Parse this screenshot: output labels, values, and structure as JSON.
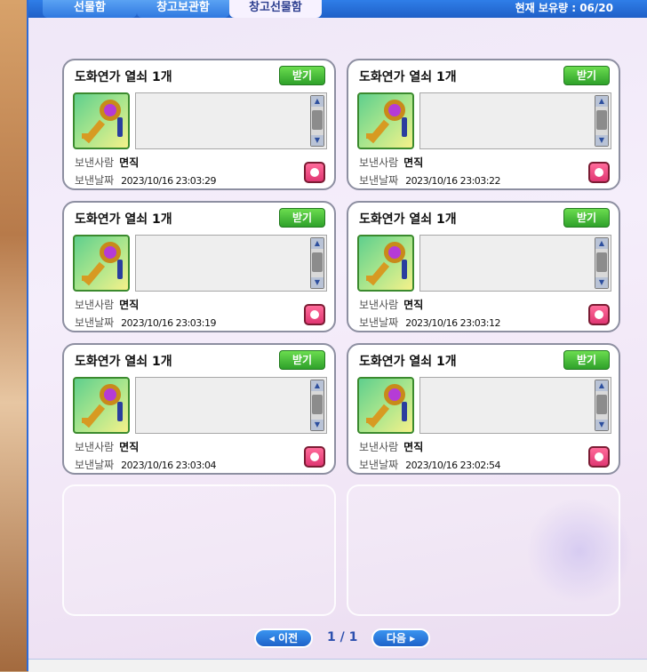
{
  "tabs": [
    {
      "label": "선물함",
      "active": false
    },
    {
      "label": "창고보관함",
      "active": false
    },
    {
      "label": "창고선물함",
      "active": true
    }
  ],
  "holding": "현재 보유량 : 06/20",
  "cards": [
    {
      "title": "도화연가 열쇠 1개",
      "receive": "받기",
      "sender_label": "보낸사람",
      "sender": "면직",
      "date_label": "보낸날짜",
      "date": "2023/10/16 23:03:29"
    },
    {
      "title": "도화연가 열쇠 1개",
      "receive": "받기",
      "sender_label": "보낸사람",
      "sender": "면직",
      "date_label": "보낸날짜",
      "date": "2023/10/16 23:03:22"
    },
    {
      "title": "도화연가 열쇠 1개",
      "receive": "받기",
      "sender_label": "보낸사람",
      "sender": "면직",
      "date_label": "보낸날짜",
      "date": "2023/10/16 23:03:19"
    },
    {
      "title": "도화연가 열쇠 1개",
      "receive": "받기",
      "sender_label": "보낸사람",
      "sender": "면직",
      "date_label": "보낸날짜",
      "date": "2023/10/16 23:03:12"
    },
    {
      "title": "도화연가 열쇠 1개",
      "receive": "받기",
      "sender_label": "보낸사람",
      "sender": "면직",
      "date_label": "보낸날짜",
      "date": "2023/10/16 23:03:04"
    },
    {
      "title": "도화연가 열쇠 1개",
      "receive": "받기",
      "sender_label": "보낸사람",
      "sender": "면직",
      "date_label": "보낸날짜",
      "date": "2023/10/16 23:02:54"
    }
  ],
  "pagination": {
    "prev": "◂ 이전",
    "next": "다음 ▸",
    "indicator": "1 / 1"
  },
  "icons": {
    "item": "key-icon",
    "delete": "trash-icon",
    "scroll_up": "arrow-up-icon",
    "scroll_down": "arrow-down-icon"
  },
  "colors": {
    "topbar": "#1f5fc7",
    "receive_button": "#2ea12a",
    "delete_button": "#e03672"
  }
}
